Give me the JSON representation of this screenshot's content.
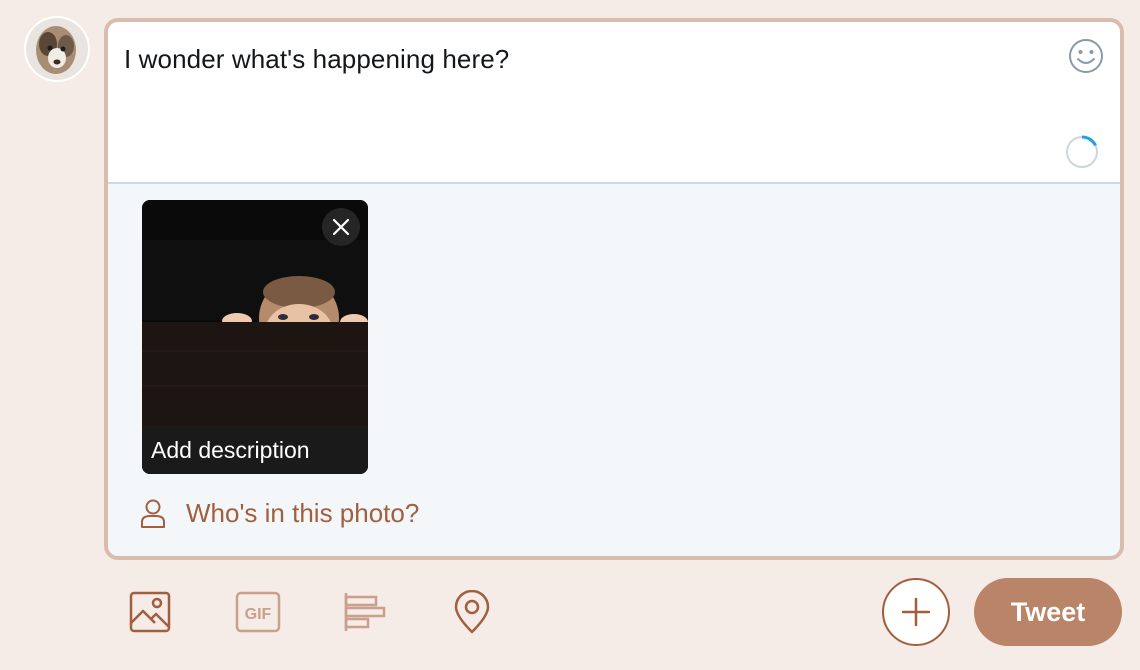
{
  "composer": {
    "text": "I wonder what's happening here?",
    "media": {
      "description_label": "Add description"
    },
    "tag_people_label": "Who's in this photo?"
  },
  "icons": {
    "emoji": "smiley-face-icon",
    "remove_media": "close-icon",
    "tag_people": "person-icon",
    "image": "image-icon",
    "gif": "gif-icon",
    "poll": "poll-icon",
    "location": "location-pin-icon",
    "add": "plus-icon"
  },
  "toolbar": {
    "gif_label": "GIF",
    "tweet_label": "Tweet"
  },
  "colors": {
    "accent": "#a25f3d",
    "tweet_button": "#b98467",
    "background": "#f5ebe7",
    "border": "#d9bcaf",
    "progress": "#1da1f2"
  }
}
